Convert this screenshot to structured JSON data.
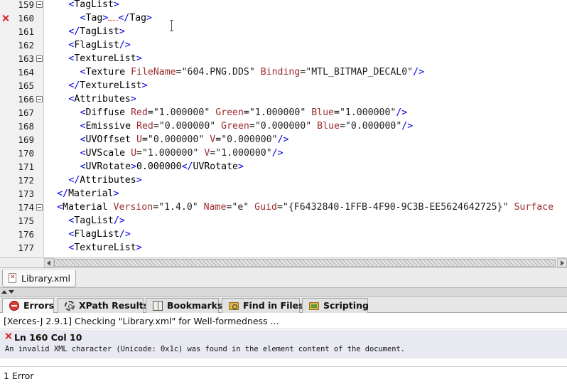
{
  "editor": {
    "lines": [
      {
        "num": "159",
        "fold": true,
        "error": false,
        "indent": 2,
        "tokens": [
          [
            "br",
            "<"
          ],
          [
            "el",
            "TagList"
          ],
          [
            "br",
            ">"
          ]
        ]
      },
      {
        "num": "160",
        "fold": false,
        "error": true,
        "indent": 3,
        "tokens": [
          [
            "br",
            "<"
          ],
          [
            "el",
            "Tag"
          ],
          [
            "br",
            ">"
          ],
          [
            "err",
            ""
          ],
          [
            "br",
            "</"
          ],
          [
            "el",
            "Tag"
          ],
          [
            "br",
            ">"
          ]
        ]
      },
      {
        "num": "161",
        "fold": false,
        "error": false,
        "indent": 2,
        "tokens": [
          [
            "br",
            "</"
          ],
          [
            "el",
            "TagList"
          ],
          [
            "br",
            ">"
          ]
        ]
      },
      {
        "num": "162",
        "fold": false,
        "error": false,
        "indent": 2,
        "tokens": [
          [
            "br",
            "<"
          ],
          [
            "el",
            "FlagList"
          ],
          [
            "br",
            "/>"
          ]
        ]
      },
      {
        "num": "163",
        "fold": true,
        "error": false,
        "indent": 2,
        "tokens": [
          [
            "br",
            "<"
          ],
          [
            "el",
            "TextureList"
          ],
          [
            "br",
            ">"
          ]
        ]
      },
      {
        "num": "164",
        "fold": false,
        "error": false,
        "indent": 3,
        "tokens": [
          [
            "br",
            "<"
          ],
          [
            "el",
            "Texture "
          ],
          [
            "at",
            "FileName"
          ],
          [
            "eq",
            "="
          ],
          [
            "va",
            "\"604.PNG.DDS\""
          ],
          [
            "tx",
            " "
          ],
          [
            "at",
            "Binding"
          ],
          [
            "eq",
            "="
          ],
          [
            "va",
            "\"MTL_BITMAP_DECAL0\""
          ],
          [
            "br",
            "/>"
          ]
        ]
      },
      {
        "num": "165",
        "fold": false,
        "error": false,
        "indent": 2,
        "tokens": [
          [
            "br",
            "</"
          ],
          [
            "el",
            "TextureList"
          ],
          [
            "br",
            ">"
          ]
        ]
      },
      {
        "num": "166",
        "fold": true,
        "error": false,
        "indent": 2,
        "tokens": [
          [
            "br",
            "<"
          ],
          [
            "el",
            "Attributes"
          ],
          [
            "br",
            ">"
          ]
        ]
      },
      {
        "num": "167",
        "fold": false,
        "error": false,
        "indent": 3,
        "tokens": [
          [
            "br",
            "<"
          ],
          [
            "el",
            "Diffuse "
          ],
          [
            "at",
            "Red"
          ],
          [
            "eq",
            "="
          ],
          [
            "va",
            "\"1.000000\""
          ],
          [
            "tx",
            " "
          ],
          [
            "at",
            "Green"
          ],
          [
            "eq",
            "="
          ],
          [
            "va",
            "\"1.000000\""
          ],
          [
            "tx",
            " "
          ],
          [
            "at",
            "Blue"
          ],
          [
            "eq",
            "="
          ],
          [
            "va",
            "\"1.000000\""
          ],
          [
            "br",
            "/>"
          ]
        ]
      },
      {
        "num": "168",
        "fold": false,
        "error": false,
        "indent": 3,
        "tokens": [
          [
            "br",
            "<"
          ],
          [
            "el",
            "Emissive "
          ],
          [
            "at",
            "Red"
          ],
          [
            "eq",
            "="
          ],
          [
            "va",
            "\"0.000000\""
          ],
          [
            "tx",
            " "
          ],
          [
            "at",
            "Green"
          ],
          [
            "eq",
            "="
          ],
          [
            "va",
            "\"0.000000\""
          ],
          [
            "tx",
            " "
          ],
          [
            "at",
            "Blue"
          ],
          [
            "eq",
            "="
          ],
          [
            "va",
            "\"0.000000\""
          ],
          [
            "br",
            "/>"
          ]
        ]
      },
      {
        "num": "169",
        "fold": false,
        "error": false,
        "indent": 3,
        "tokens": [
          [
            "br",
            "<"
          ],
          [
            "el",
            "UVOffset "
          ],
          [
            "at",
            "U"
          ],
          [
            "eq",
            "="
          ],
          [
            "va",
            "\"0.000000\""
          ],
          [
            "tx",
            " "
          ],
          [
            "at",
            "V"
          ],
          [
            "eq",
            "="
          ],
          [
            "va",
            "\"0.000000\""
          ],
          [
            "br",
            "/>"
          ]
        ]
      },
      {
        "num": "170",
        "fold": false,
        "error": false,
        "indent": 3,
        "tokens": [
          [
            "br",
            "<"
          ],
          [
            "el",
            "UVScale "
          ],
          [
            "at",
            "U"
          ],
          [
            "eq",
            "="
          ],
          [
            "va",
            "\"1.000000\""
          ],
          [
            "tx",
            " "
          ],
          [
            "at",
            "V"
          ],
          [
            "eq",
            "="
          ],
          [
            "va",
            "\"1.000000\""
          ],
          [
            "br",
            "/>"
          ]
        ]
      },
      {
        "num": "171",
        "fold": false,
        "error": false,
        "indent": 3,
        "tokens": [
          [
            "br",
            "<"
          ],
          [
            "el",
            "UVRotate"
          ],
          [
            "br",
            ">"
          ],
          [
            "tx",
            "0.000000"
          ],
          [
            "br",
            "</"
          ],
          [
            "el",
            "UVRotate"
          ],
          [
            "br",
            ">"
          ]
        ]
      },
      {
        "num": "172",
        "fold": false,
        "error": false,
        "indent": 2,
        "tokens": [
          [
            "br",
            "</"
          ],
          [
            "el",
            "Attributes"
          ],
          [
            "br",
            ">"
          ]
        ]
      },
      {
        "num": "173",
        "fold": false,
        "error": false,
        "indent": 1,
        "tokens": [
          [
            "br",
            "</"
          ],
          [
            "el",
            "Material"
          ],
          [
            "br",
            ">"
          ]
        ]
      },
      {
        "num": "174",
        "fold": true,
        "error": false,
        "indent": 1,
        "tokens": [
          [
            "br",
            "<"
          ],
          [
            "el",
            "Material "
          ],
          [
            "at",
            "Version"
          ],
          [
            "eq",
            "="
          ],
          [
            "va",
            "\"1.4.0\""
          ],
          [
            "tx",
            " "
          ],
          [
            "at",
            "Name"
          ],
          [
            "eq",
            "="
          ],
          [
            "va",
            "\"e\""
          ],
          [
            "tx",
            " "
          ],
          [
            "at",
            "Guid"
          ],
          [
            "eq",
            "="
          ],
          [
            "va",
            "\"{F6432840-1FFB-4F90-9C3B-EE5624642725}\""
          ],
          [
            "tx",
            " "
          ],
          [
            "at",
            "Surface"
          ]
        ]
      },
      {
        "num": "175",
        "fold": false,
        "error": false,
        "indent": 2,
        "tokens": [
          [
            "br",
            "<"
          ],
          [
            "el",
            "TagList"
          ],
          [
            "br",
            "/>"
          ]
        ]
      },
      {
        "num": "176",
        "fold": false,
        "error": false,
        "indent": 2,
        "tokens": [
          [
            "br",
            "<"
          ],
          [
            "el",
            "FlagList"
          ],
          [
            "br",
            "/>"
          ]
        ]
      },
      {
        "num": "177",
        "fold": false,
        "error": false,
        "indent": 2,
        "tokens": [
          [
            "br",
            "<"
          ],
          [
            "el",
            "TextureList"
          ],
          [
            "br",
            ">"
          ]
        ]
      }
    ]
  },
  "doc_tab": {
    "label": "Library.xml",
    "icon": "xml-error-file-icon"
  },
  "panel_tabs": [
    {
      "label": "Errors",
      "icon": "error-icon",
      "active": true
    },
    {
      "label": "XPath Results",
      "icon": "gear-icon",
      "active": false
    },
    {
      "label": "Bookmarks",
      "icon": "bookmark-icon",
      "active": false
    },
    {
      "label": "Find in Files",
      "icon": "find-folder-icon",
      "active": false
    },
    {
      "label": "Scripting",
      "icon": "script-folder-icon",
      "active": false
    }
  ],
  "errors_panel": {
    "header": "[Xerces-J 2.9.1] Checking \"Library.xml\" for Well-formedness ...",
    "entries": [
      {
        "location": "Ln 160 Col 10",
        "message": "An invalid XML character (Unicode: 0x1c) was found in the element content of the document."
      }
    ],
    "footer": "1 Error"
  },
  "colors": {
    "bracket": "#0000e6",
    "attribute": "#9c2d2d",
    "error": "#d6262a",
    "gutter": "#f1f1f1",
    "error_row": "#e9eaf1"
  }
}
